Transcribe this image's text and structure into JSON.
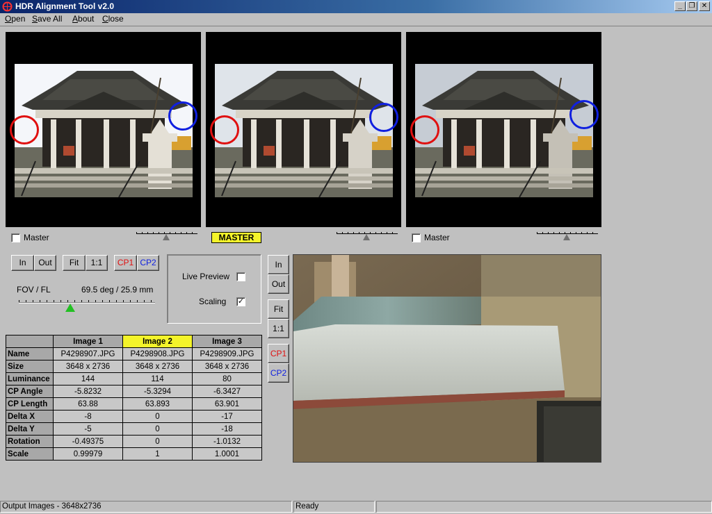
{
  "window": {
    "title": "HDR Alignment Tool  v2.0",
    "minimize_glyph": "_",
    "maximize_glyph": "❐",
    "close_glyph": "✕"
  },
  "menu": [
    {
      "accel": "O",
      "rest": "pen"
    },
    {
      "accel": "S",
      "rest": "ave All"
    },
    {
      "accel": "A",
      "rest": "bout"
    },
    {
      "accel": "C",
      "rest": "lose"
    }
  ],
  "panels": [
    {
      "master_label": "Master",
      "is_master": false,
      "slider_value": 0.5
    },
    {
      "master_label": "MASTER",
      "is_master": true,
      "slider_value": 0.5
    },
    {
      "master_label": "Master",
      "is_master": false,
      "slider_value": 0.5
    }
  ],
  "controls": {
    "zoom_in": "In",
    "zoom_out": "Out",
    "fit": "Fit",
    "one_to_one": "1:1",
    "cp1": "CP1",
    "cp2": "CP2",
    "fov_label": "FOV / FL",
    "fov_value": "69.5 deg / 25.9 mm",
    "fov_slider_fraction": 0.38,
    "live_preview_label": "Live Preview",
    "live_preview_checked": false,
    "scaling_label": "Scaling",
    "scaling_checked": true
  },
  "colors": {
    "cp1": "#e01010",
    "cp2": "#1020e0",
    "master_highlight": "#f4f42a",
    "fov_thumb": "#22c022"
  },
  "table": {
    "headers": [
      "Image 1",
      "Image 2",
      "Image 3"
    ],
    "highlight_column": 1,
    "rows": [
      {
        "label": "Name",
        "values": [
          "P4298907.JPG",
          "P4298908.JPG",
          "P4298909.JPG"
        ]
      },
      {
        "label": "Size",
        "values": [
          "3648 x 2736",
          "3648 x 2736",
          "3648 x 2736"
        ]
      },
      {
        "label": "Luminance",
        "values": [
          "144",
          "114",
          "80"
        ]
      },
      {
        "label": "CP Angle",
        "values": [
          "-5.8232",
          "-5.3294",
          "-6.3427"
        ]
      },
      {
        "label": "CP Length",
        "values": [
          "63.88",
          "63.893",
          "63.901"
        ]
      },
      {
        "label": "Delta X",
        "values": [
          "-8",
          "0",
          "-17"
        ]
      },
      {
        "label": "Delta Y",
        "values": [
          "-5",
          "0",
          "-18"
        ]
      },
      {
        "label": "Rotation",
        "values": [
          "-0.49375",
          "0",
          "-1.0132"
        ]
      },
      {
        "label": "Scale",
        "values": [
          "0.99979",
          "1",
          "1.0001"
        ]
      }
    ]
  },
  "status": {
    "output": "Output Images - 3648x2736",
    "state": "Ready",
    "extra": ""
  }
}
